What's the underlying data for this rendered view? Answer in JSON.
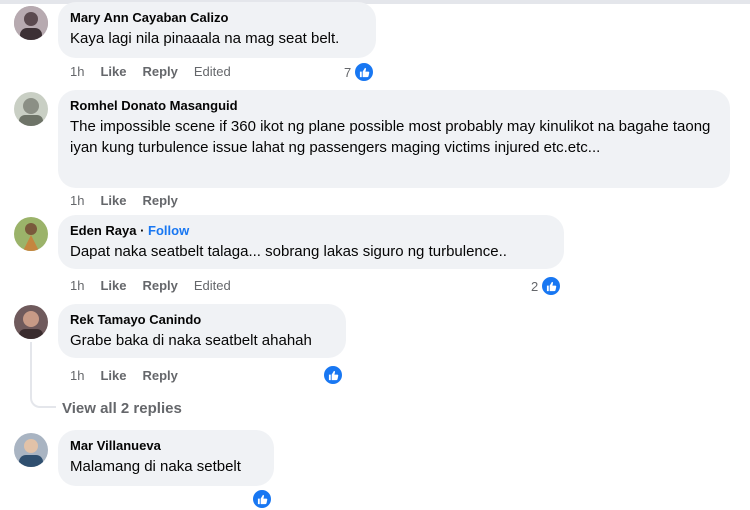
{
  "actions": {
    "like": "Like",
    "reply": "Reply",
    "edited": "Edited"
  },
  "comments": [
    {
      "author": "Mary Ann Cayaban Calizo",
      "text": "Kaya lagi nila pinaaala na mag seat belt.",
      "time": "1h",
      "reactions": "7"
    },
    {
      "author": "Romhel Donato Masanguid",
      "text": "The impossible scene if 360 ikot ng plane possible most probably may kinulikot na bagahe taong iyan kung turbulence issue lahat ng passengers maging victims injured etc.etc...",
      "time": "1h"
    },
    {
      "author": "Eden Raya",
      "follow_sep": " · ",
      "follow": "Follow",
      "text": "Dapat naka seatbelt talaga... sobrang lakas siguro ng turbulence..",
      "time": "1h",
      "reactions": "2"
    },
    {
      "author": "Rek Tamayo Canindo",
      "text": "Grabe baka di naka seatbelt ahahah",
      "time": "1h"
    },
    {
      "author": "Mar Villanueva",
      "text": "Malamang di naka setbelt"
    }
  ],
  "view_replies": "View all 2 replies",
  "colors": {
    "accent": "#1877f2",
    "bubble": "#f0f2f5",
    "meta": "#65676b"
  },
  "icons": {
    "reaction": "thumbs-up-icon"
  }
}
